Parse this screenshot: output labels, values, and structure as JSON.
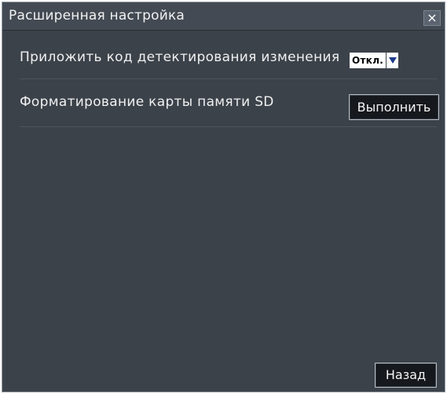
{
  "dialog": {
    "title": "Расширенная настройка",
    "close_symbol": "×"
  },
  "settings": [
    {
      "label": "Приложить код детектирования изменения",
      "control": "select",
      "value": "Откл."
    },
    {
      "label": "Форматирование карты памяти SD",
      "control": "button",
      "button_label": "Выполнить"
    }
  ],
  "footer": {
    "back_label": "Назад"
  },
  "colors": {
    "panel_background": "#3c424a",
    "button_background": "#15181c",
    "text": "#f0f0f0"
  }
}
